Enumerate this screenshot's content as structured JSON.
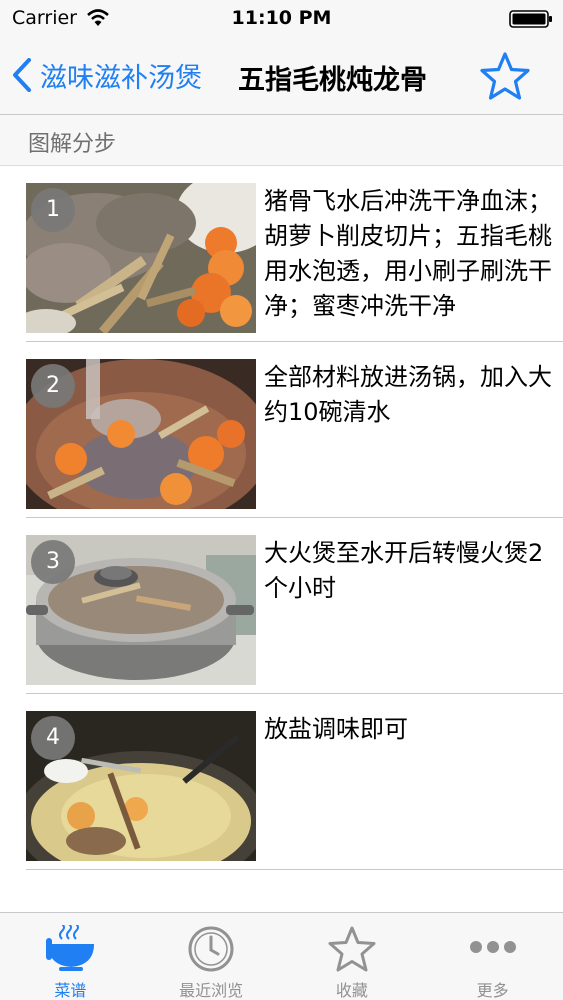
{
  "status_bar": {
    "carrier": "Carrier",
    "time": "11:10 PM"
  },
  "nav": {
    "back_label": "滋味滋补汤煲",
    "title": "五指毛桃炖龙骨",
    "favorite_icon": "star-outline-icon"
  },
  "section": {
    "title": "图解分步"
  },
  "steps": [
    {
      "number": "1",
      "text": "猪骨飞水后冲洗干净血沫；胡萝卜削皮切片；五指毛桃用水泡透，用小刷子刷洗干净；蜜枣冲洗干净"
    },
    {
      "number": "2",
      "text": "全部材料放进汤锅，加入大约10碗清水"
    },
    {
      "number": "3",
      "text": "大火煲至水开后转慢火煲2个小时"
    },
    {
      "number": "4",
      "text": "放盐调味即可"
    }
  ],
  "tabs": [
    {
      "label": "菜谱",
      "icon": "bowl-icon",
      "active": true
    },
    {
      "label": "最近浏览",
      "icon": "clock-icon",
      "active": false
    },
    {
      "label": "收藏",
      "icon": "star-icon",
      "active": false
    },
    {
      "label": "更多",
      "icon": "more-icon",
      "active": false
    }
  ],
  "colors": {
    "accent": "#1f7ff3",
    "inactive": "#929292"
  }
}
